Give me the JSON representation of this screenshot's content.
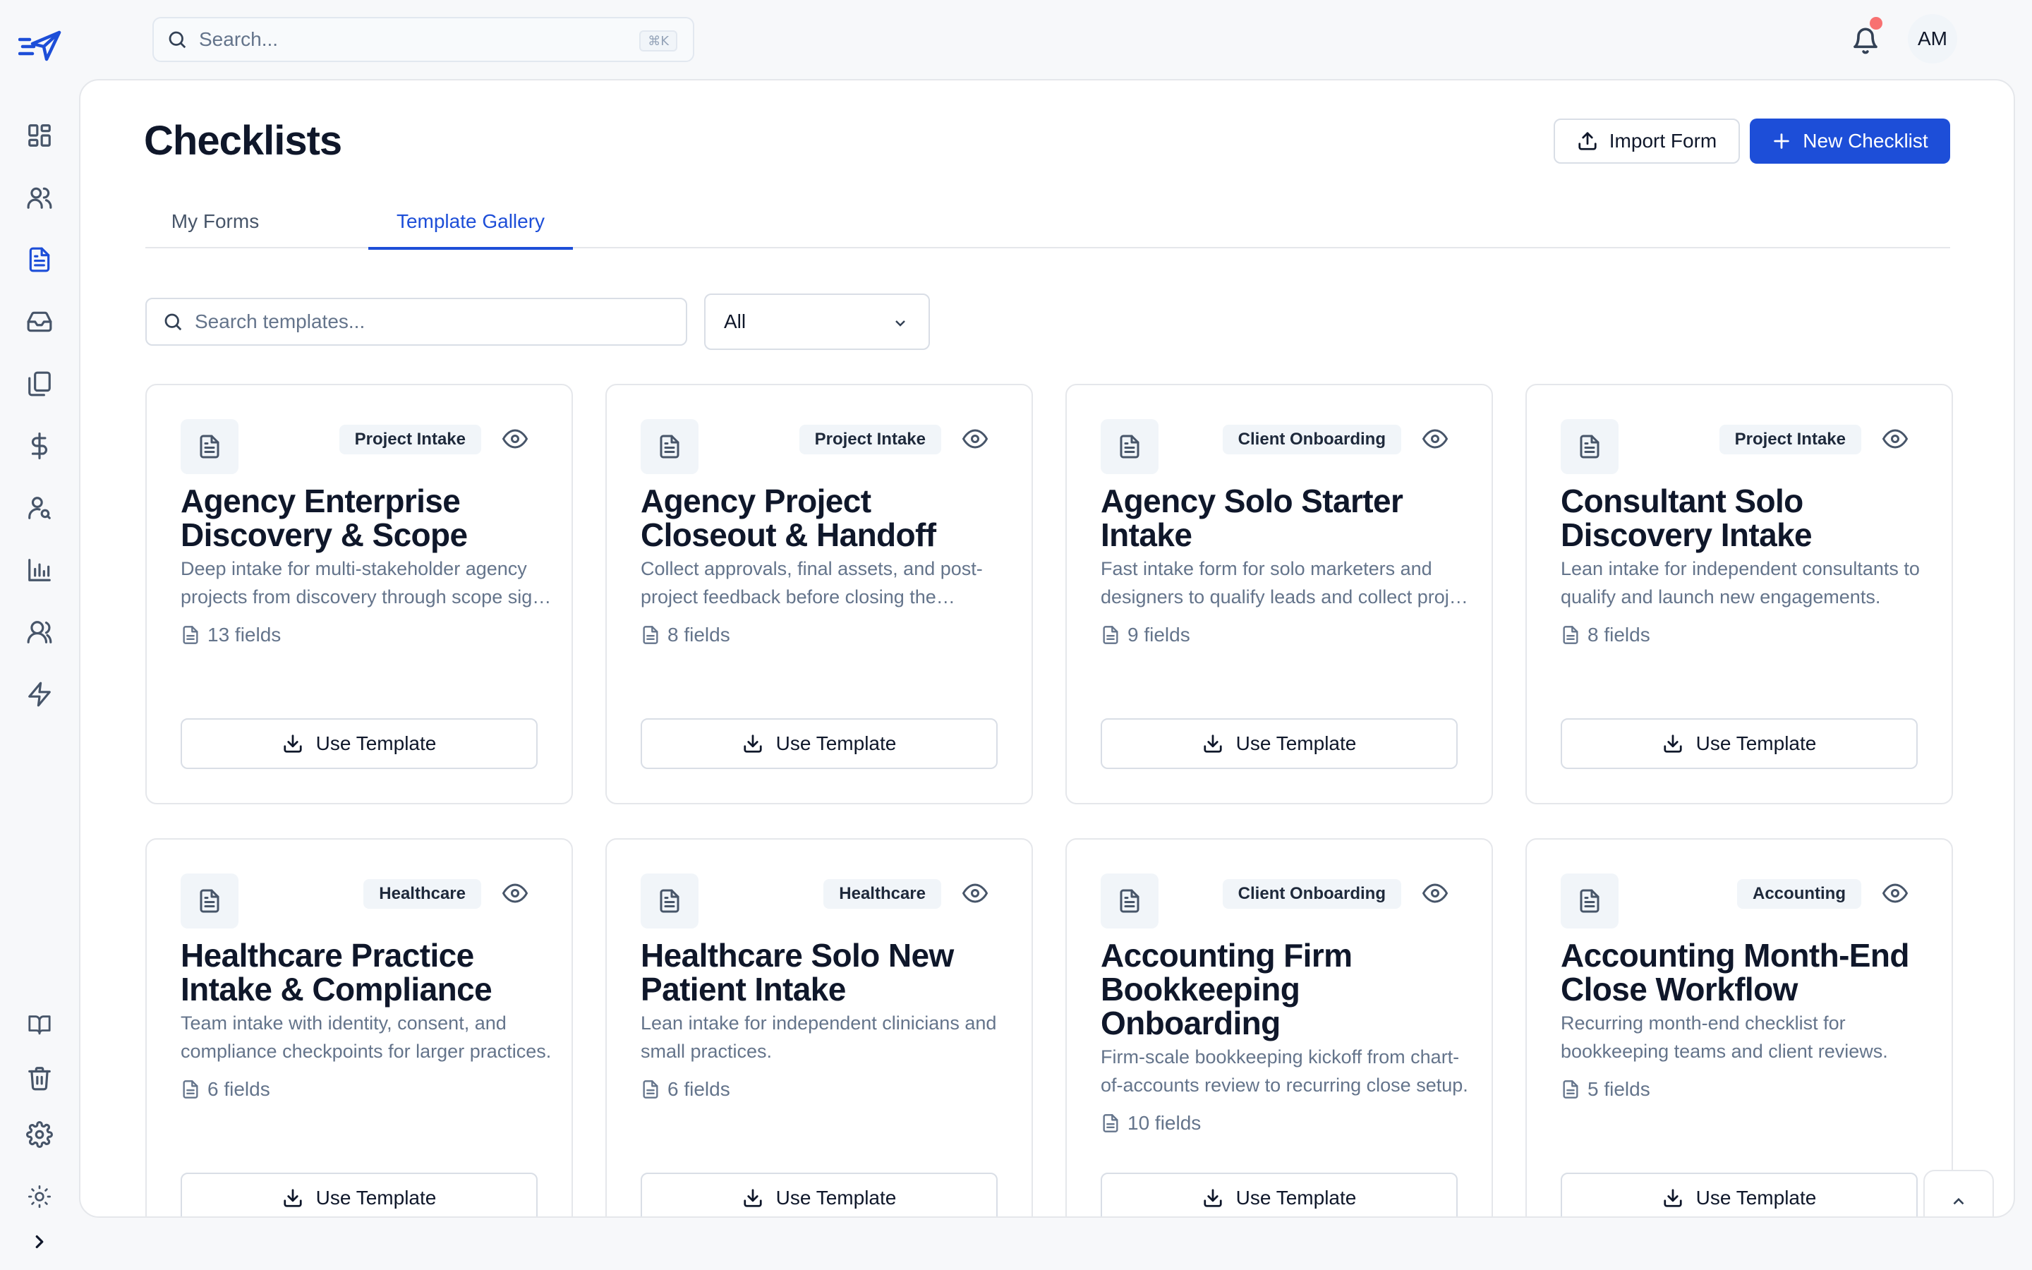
{
  "topbar": {
    "search_placeholder": "Search...",
    "shortcut": "⌘K",
    "avatar_initials": "AM",
    "notification_color": "#f87171"
  },
  "rail": {
    "nav_icons": [
      "dashboard-icon",
      "users-icon",
      "document-icon",
      "inbox-icon",
      "copy-icon",
      "dollar-icon",
      "user-search-icon",
      "bar-chart-icon",
      "team-icon",
      "lightning-icon"
    ],
    "active_icon": "document-icon",
    "bottom_icons": [
      "book-icon",
      "trash-icon",
      "gear-icon",
      "sun-icon",
      "chevron-right-icon"
    ]
  },
  "page": {
    "title": "Checklists",
    "import_label": "Import Form",
    "new_label": "New Checklist",
    "accent_color": "#1d4ed8"
  },
  "tabs": [
    {
      "label": "My Forms",
      "active": false
    },
    {
      "label": "Template Gallery",
      "active": true
    }
  ],
  "filters": {
    "search_placeholder": "Search templates...",
    "category_selected": "All"
  },
  "templates": [
    {
      "category": "Project Intake",
      "title": "Agency Enterprise Discovery & Scope",
      "description": "Deep intake for multi-stakeholder agency projects from discovery through scope sign-off.",
      "fields": "13 fields",
      "button": "Use Template"
    },
    {
      "category": "Project Intake",
      "title": "Agency Project Closeout & Handoff",
      "description": "Collect approvals, final assets, and post-project feedback before closing the engagement.",
      "fields": "8 fields",
      "button": "Use Template"
    },
    {
      "category": "Client Onboarding",
      "title": "Agency Solo Starter Intake",
      "description": "Fast intake form for solo marketers and designers to qualify leads and collect project basics.",
      "fields": "9 fields",
      "button": "Use Template"
    },
    {
      "category": "Project Intake",
      "title": "Consultant Solo Discovery Intake",
      "description": "Lean intake for independent consultants to qualify and launch new engagements.",
      "fields": "8 fields",
      "button": "Use Template"
    },
    {
      "category": "Healthcare",
      "title": "Healthcare Practice Intake & Compliance",
      "description": "Team intake with identity, consent, and compliance checkpoints for larger practices.",
      "fields": "6 fields",
      "button": "Use Template"
    },
    {
      "category": "Healthcare",
      "title": "Healthcare Solo New Patient Intake",
      "description": "Lean intake for independent clinicians and small practices.",
      "fields": "6 fields",
      "button": "Use Template"
    },
    {
      "category": "Client Onboarding",
      "title": "Accounting Firm Bookkeeping Onboarding",
      "description": "Firm-scale bookkeeping kickoff from chart-of-accounts review to recurring close setup.",
      "fields": "10 fields",
      "button": "Use Template"
    },
    {
      "category": "Accounting",
      "title": "Accounting Month-End Close Workflow",
      "description": "Recurring month-end checklist for bookkeeping teams and client reviews.",
      "fields": "5 fields",
      "button": "Use Template"
    }
  ]
}
